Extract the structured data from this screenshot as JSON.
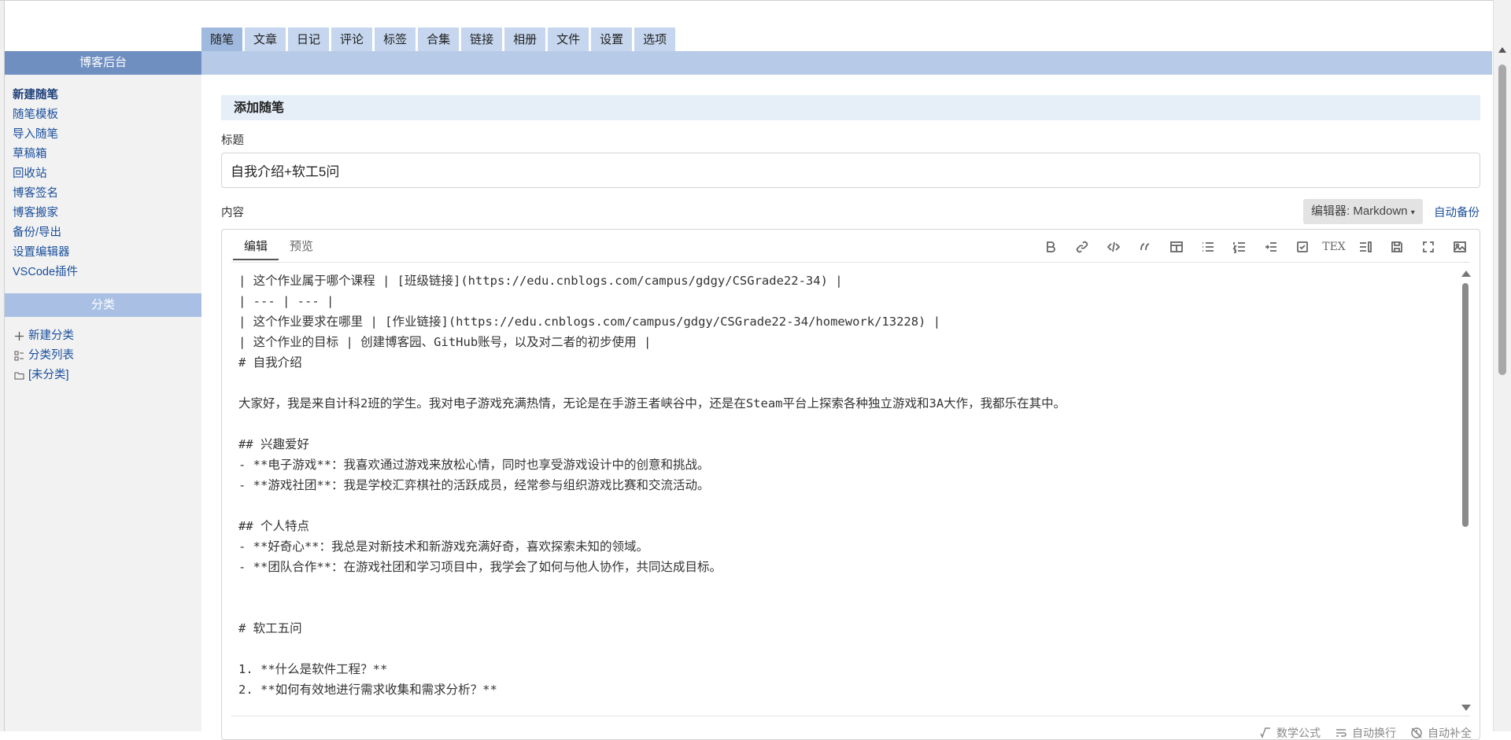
{
  "top_nav": {
    "tabs": [
      "随笔",
      "文章",
      "日记",
      "评论",
      "标签",
      "合集",
      "链接",
      "相册",
      "文件",
      "设置",
      "选项"
    ],
    "active_index": 0
  },
  "sidebar": {
    "header": "博客后台",
    "links": [
      "新建随笔",
      "随笔模板",
      "导入随笔",
      "草稿箱",
      "回收站",
      "博客签名",
      "博客搬家",
      "备份/导出",
      "设置编辑器",
      "VSCode插件"
    ],
    "category_header": "分类",
    "category_links": [
      {
        "icon": "plus-icon",
        "label": "新建分类"
      },
      {
        "icon": "list-icon",
        "label": "分类列表"
      },
      {
        "icon": "folder-icon",
        "label": "[未分类]"
      }
    ]
  },
  "main": {
    "section_title": "添加随笔",
    "title_label": "标题",
    "title_value": "自我介绍+软工5问",
    "content_label": "内容",
    "editor_select": "编辑器: Markdown",
    "auto_backup": "自动备份",
    "editor_tabs": [
      "编辑",
      "预览"
    ],
    "toolbar_icons": [
      "bold-icon",
      "link-icon",
      "code-icon",
      "quote-icon",
      "table-icon",
      "unordered-list-icon",
      "ordered-list-icon",
      "indent-icon",
      "checkbox-icon",
      "tex-icon",
      "toc-icon",
      "save-icon",
      "fullscreen-icon",
      "image-icon"
    ],
    "tex_label": "TEX",
    "content_lines": [
      "| 这个作业属于哪个课程 | [班级链接](https://edu.cnblogs.com/campus/gdgy/CSGrade22-34) |",
      "| --- | --- |",
      "| 这个作业要求在哪里 | [作业链接](https://edu.cnblogs.com/campus/gdgy/CSGrade22-34/homework/13228) |",
      "| 这个作业的目标 | 创建博客园、GitHub账号，以及对二者的初步使用 |",
      "# 自我介绍",
      "",
      "大家好，我是来自计科2班的学生。我对电子游戏充满热情，无论是在手游王者峡谷中，还是在Steam平台上探索各种独立游戏和3A大作，我都乐在其中。",
      "",
      "## 兴趣爱好",
      "- **电子游戏**：我喜欢通过游戏来放松心情，同时也享受游戏设计中的创意和挑战。",
      "- **游戏社团**：我是学校汇弈棋社的活跃成员，经常参与组织游戏比赛和交流活动。",
      "",
      "## 个人特点",
      "- **好奇心**：我总是对新技术和新游戏充满好奇，喜欢探索未知的领域。",
      "- **团队合作**：在游戏社团和学习项目中，我学会了如何与他人协作，共同达成目标。",
      "",
      "",
      "# 软工五问",
      "",
      "1. **什么是软件工程？**",
      "2. **如何有效地进行需求收集和需求分析？**"
    ],
    "status_items": [
      "数学公式",
      "自动换行",
      "自动补全"
    ]
  }
}
